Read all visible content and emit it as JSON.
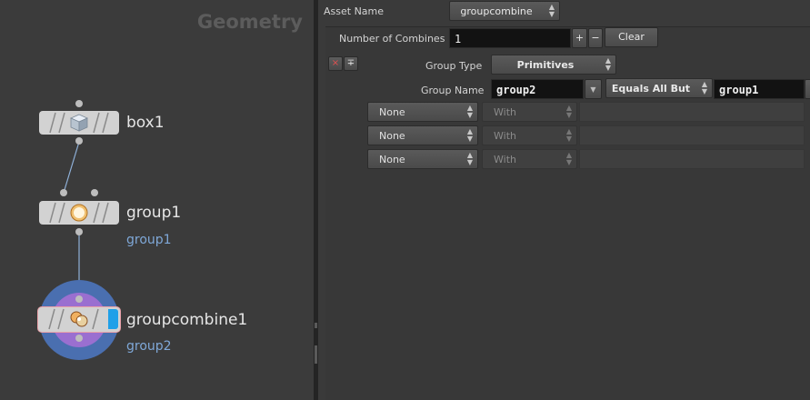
{
  "network": {
    "title": "Geometry",
    "nodes": [
      {
        "name": "box1",
        "sub": ""
      },
      {
        "name": "group1",
        "sub": "group1"
      },
      {
        "name": "groupcombine1",
        "sub": "group2"
      }
    ]
  },
  "params": {
    "asset_name_label": "Asset Name",
    "asset_name_value": "groupcombine",
    "num_combines_label": "Number of Combines",
    "num_combines_value": "1",
    "plus_label": "+",
    "minus_label": "−",
    "clear_label": "Clear",
    "remove_label": "×",
    "insert_label": "∓",
    "group_type_label": "Group Type",
    "group_type_value": "Primitives",
    "group_name_label": "Group Name",
    "group_name_value": "group2",
    "operation_value": "Equals All But",
    "operand_value": "group1",
    "rows": [
      {
        "op": "None",
        "with": "With"
      },
      {
        "op": "None",
        "with": "With"
      },
      {
        "op": "None",
        "with": "With"
      }
    ]
  },
  "colors": {
    "sub_label": "#7fa8d8",
    "selected_ring_outer": "#4a6fb0",
    "selected_ring_inner": "#9a6fd0",
    "display_flag": "#1fa0e8"
  }
}
